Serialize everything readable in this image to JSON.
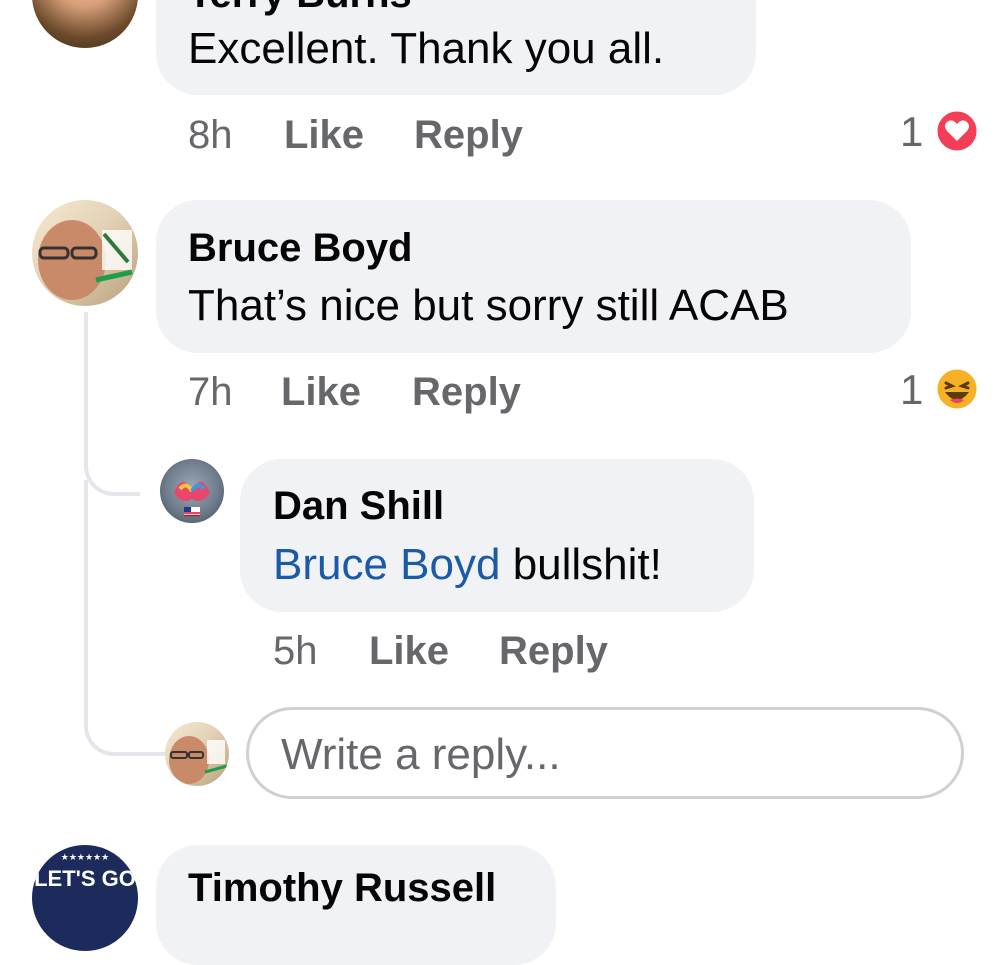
{
  "comments": [
    {
      "author": "Terry Burns",
      "text": "Excellent. Thank you all.",
      "time": "8h",
      "like_label": "Like",
      "reply_label": "Reply",
      "reaction_count": "1",
      "reaction_icon": "heart-reaction-icon"
    },
    {
      "author": "Bruce Boyd",
      "text": "That’s nice but sorry still ACAB",
      "time": "7h",
      "like_label": "Like",
      "reply_label": "Reply",
      "reaction_count": "1",
      "reaction_icon": "haha-reaction-icon"
    }
  ],
  "reply": {
    "author": "Dan Shill",
    "mention": "Bruce Boyd",
    "text": " bullshit!",
    "time": "5h",
    "like_label": "Like",
    "reply_label": "Reply"
  },
  "reply_input": {
    "placeholder": "Write a reply..."
  },
  "next_comment": {
    "author": "Timothy Russell",
    "avatar_text": "LET'S GO"
  },
  "colors": {
    "bubble": "#f0f2f5",
    "meta": "#65676b",
    "mention": "#1b5aa6",
    "heart": "#f33e58",
    "haha": "#f7b125"
  }
}
